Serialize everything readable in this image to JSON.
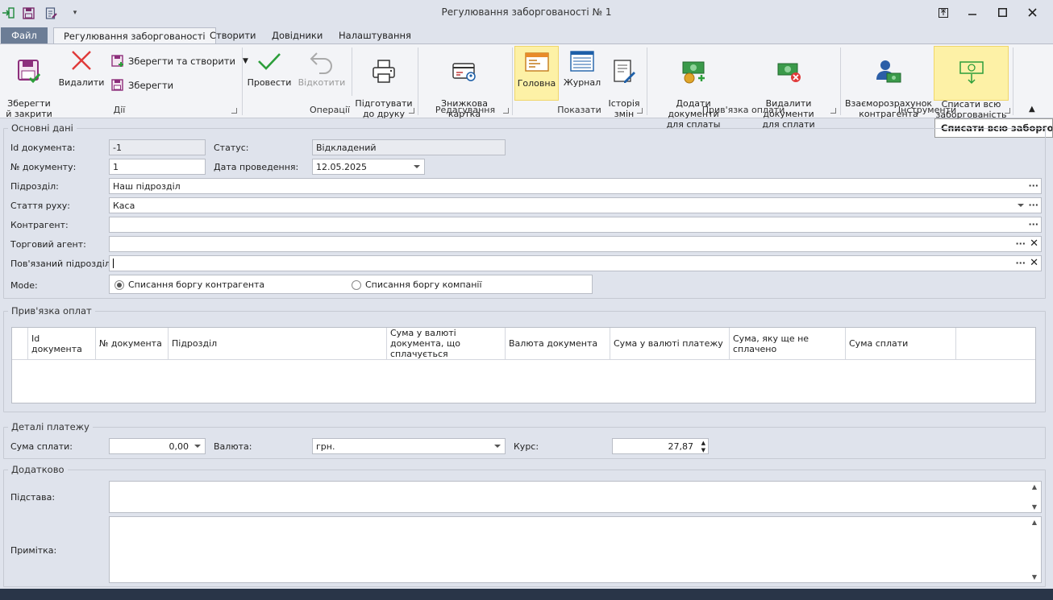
{
  "window": {
    "title": "Регулювання заборгованості № 1",
    "controls": [
      "restore-to-top",
      "minimize",
      "maximize",
      "close"
    ]
  },
  "tabs": {
    "file": "Файл",
    "active": "Регулювання заборгованості",
    "create": "Створити",
    "directories": "Довідники",
    "settings": "Налаштування"
  },
  "ribbon": {
    "save_close": "Зберегти\nй закрити",
    "delete": "Видалити",
    "save_create": "Зберегти та створити",
    "save": "Зберегти",
    "group_actions": "Дії",
    "post": "Провести",
    "rollback": "Відкотити",
    "print": "Підготувати\nдо друку",
    "group_operations": "Операції",
    "discount_card": "Знижкова\nкартка",
    "group_edit": "Редагування",
    "main": "Головна",
    "journal": "Журнал",
    "history": "Історія\nзмін",
    "group_show": "Показати",
    "add_docs": "Додати документи\nдля сплаты",
    "remove_docs": "Видалити документи\nдля сплати",
    "group_payment_link": "Прив'язка оплати",
    "mutual": "Взаєморозрахунок\nконтрагента",
    "write_off": "Списати всю\nзаборгованість",
    "group_tools": "Інструменти"
  },
  "tooltip": "Списати всю заборгованість",
  "main_data": {
    "legend": "Основні дані",
    "doc_id_label": "Id документа:",
    "doc_id": "-1",
    "status_label": "Статус:",
    "status": "Відкладений",
    "doc_no_label": "№ документу:",
    "doc_no": "1",
    "date_label": "Дата проведення:",
    "date": "12.05.2025",
    "division_label": "Підрозділ:",
    "division": "Наш підрозділ",
    "movement_label": "Стаття руху:",
    "movement": "Каса",
    "counterparty_label": "Контрагент:",
    "counterparty": "",
    "agent_label": "Торговий агент:",
    "agent": "",
    "linked_division_label": "Пов'язаний підрозділ:",
    "linked_division": "",
    "mode_label": "Mode:",
    "mode_option1": "Списання боргу контрагента",
    "mode_option2": "Списання боргу компанії",
    "mode_selected": 1
  },
  "payments": {
    "legend": "Прив'язка оплат",
    "columns": [
      "Id документа",
      "№ документа",
      "Підрозділ",
      "Сума у валюті документа, що сплачується",
      "Валюта документа",
      "Сума у валюті платежу",
      "Сума, яку ще не сплачено",
      "Сума сплати"
    ],
    "rows": []
  },
  "payment_details": {
    "legend": "Деталі платежу",
    "amount_label": "Сума сплати:",
    "amount": "0,00",
    "currency_label": "Валюта:",
    "currency": "грн.",
    "rate_label": "Курс:",
    "rate": "27,87"
  },
  "extra": {
    "legend": "Додатково",
    "basis_label": "Підстава:",
    "basis": "",
    "note_label": "Примітка:",
    "note": ""
  },
  "colors": {
    "background": "#dfe3ec",
    "file_tab": "#6c7d96",
    "highlight": "#fdf1a6",
    "status_bar": "#293548"
  }
}
